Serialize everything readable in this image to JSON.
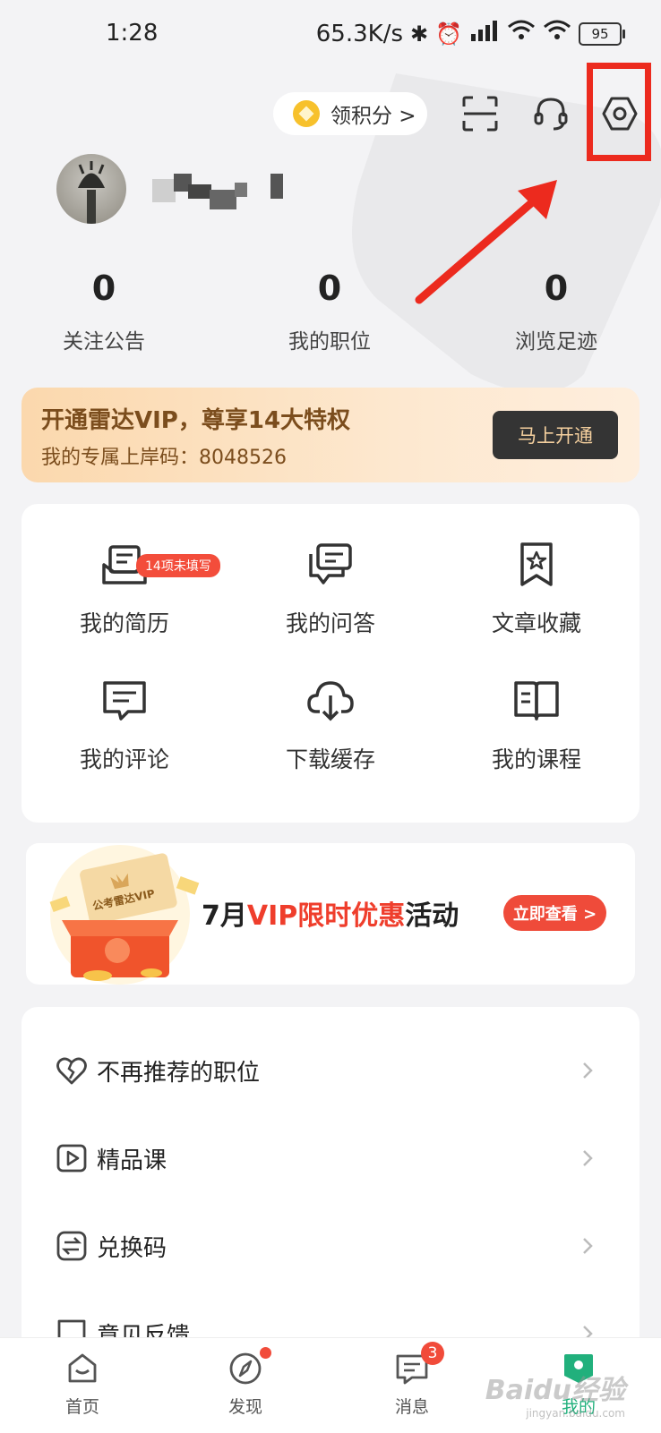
{
  "status": {
    "time": "1:28",
    "net_speed": "65.3K/s",
    "battery": "95"
  },
  "header": {
    "points_label": "领积分 >"
  },
  "stats": [
    {
      "value": "0",
      "label": "关注公告"
    },
    {
      "value": "0",
      "label": "我的职位"
    },
    {
      "value": "0",
      "label": "浏览足迹"
    }
  ],
  "vip": {
    "title": "开通雷达VIP，尊享14大特权",
    "subtitle": "我的专属上岸码：8048526",
    "button": "马上开通"
  },
  "grid": {
    "resume_badge": "14项未填写",
    "items": [
      {
        "label": "我的简历",
        "icon": "resume-icon"
      },
      {
        "label": "我的问答",
        "icon": "qa-icon"
      },
      {
        "label": "文章收藏",
        "icon": "bookmark-star-icon"
      },
      {
        "label": "我的评论",
        "icon": "comment-icon"
      },
      {
        "label": "下载缓存",
        "icon": "cloud-download-icon"
      },
      {
        "label": "我的课程",
        "icon": "book-icon"
      }
    ]
  },
  "promo": {
    "part1": "7月",
    "part2": "VIP限时优惠",
    "part3": "活动",
    "button": "立即查看 >",
    "card_text": "公考雷达VIP"
  },
  "list": [
    {
      "label": "不再推荐的职位",
      "icon": "broken-heart-icon"
    },
    {
      "label": "精品课",
      "icon": "play-icon"
    },
    {
      "label": "兑换码",
      "icon": "exchange-icon"
    },
    {
      "label": "意见反馈",
      "icon": "feedback-icon"
    }
  ],
  "nav": {
    "items": [
      {
        "label": "首页"
      },
      {
        "label": "发现"
      },
      {
        "label": "消息"
      },
      {
        "label": "我的"
      }
    ],
    "message_badge": "3"
  },
  "watermark": {
    "main": "Baidu经验",
    "sub": "jingyan.baidu.com"
  },
  "colors": {
    "accent_red": "#ef3e2c",
    "vip_brown": "#7b4d1d",
    "nav_active": "#21b07c",
    "highlight": "#ec2a1e"
  }
}
